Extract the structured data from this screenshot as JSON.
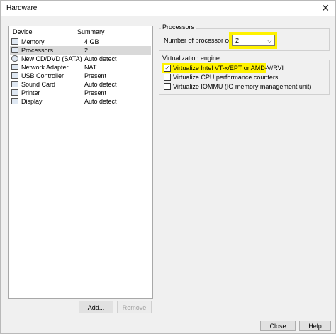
{
  "window": {
    "title": "Hardware"
  },
  "devices": {
    "headers": {
      "device": "Device",
      "summary": "Summary"
    },
    "items": [
      {
        "name": "Memory",
        "summary": "4 GB",
        "icon": "memory-icon"
      },
      {
        "name": "Processors",
        "summary": "2",
        "icon": "processor-icon"
      },
      {
        "name": "New CD/DVD (SATA)",
        "summary": "Auto detect",
        "icon": "cd-dvd-icon"
      },
      {
        "name": "Network Adapter",
        "summary": "NAT",
        "icon": "network-icon"
      },
      {
        "name": "USB Controller",
        "summary": "Present",
        "icon": "usb-icon"
      },
      {
        "name": "Sound Card",
        "summary": "Auto detect",
        "icon": "sound-icon"
      },
      {
        "name": "Printer",
        "summary": "Present",
        "icon": "printer-icon"
      },
      {
        "name": "Display",
        "summary": "Auto detect",
        "icon": "display-icon"
      }
    ],
    "selected": "Processors"
  },
  "buttons": {
    "add": "Add...",
    "remove": "Remove",
    "close": "Close",
    "help": "Help"
  },
  "processors": {
    "group_title": "Processors",
    "cores_label": "Number of processor cores:",
    "cores_value": "2"
  },
  "virtualization": {
    "group_title": "Virtualization engine",
    "options": [
      {
        "label": "Virtualize Intel VT-x/EPT or AMD-V/RVI",
        "checked": true
      },
      {
        "label": "Virtualize CPU performance counters",
        "checked": false
      },
      {
        "label": "Virtualize IOMMU (IO memory management unit)",
        "checked": false
      }
    ]
  },
  "colors": {
    "highlight": "#fff200",
    "selection": "#d9d9d9",
    "background": "#f0f0f0"
  }
}
